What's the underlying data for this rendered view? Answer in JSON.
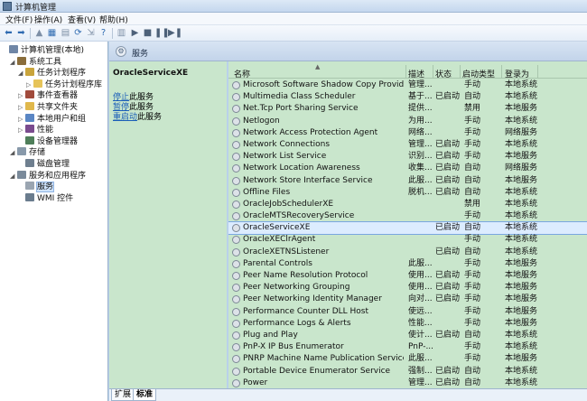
{
  "window": {
    "title": "计算机管理"
  },
  "menu": [
    "文件(F)",
    "操作(A)",
    "查看(V)",
    "帮助(H)"
  ],
  "toolbar": {
    "icons": [
      "back-icon",
      "forward-icon",
      "up-icon",
      "show-hide-tree-icon",
      "properties-icon",
      "refresh-icon",
      "export-icon",
      "help-icon",
      "play-icon",
      "stop-icon",
      "pause-icon",
      "restart-icon"
    ]
  },
  "tree": {
    "items": [
      {
        "label": "计算机管理(本地)",
        "level": 0,
        "twisty": "",
        "icon": "computer-icon",
        "color": "#6f86a6"
      },
      {
        "label": "系统工具",
        "level": 1,
        "twisty": "◢",
        "icon": "tools-icon",
        "color": "#8a6d3b"
      },
      {
        "label": "任务计划程序",
        "level": 2,
        "twisty": "◢",
        "icon": "clock-icon",
        "color": "#c9a43b"
      },
      {
        "label": "任务计划程序库",
        "level": 3,
        "twisty": "▷",
        "icon": "folder-icon",
        "color": "#e6c45a"
      },
      {
        "label": "事件查看器",
        "level": 2,
        "twisty": "▷",
        "icon": "event-viewer-icon",
        "color": "#a14b3c"
      },
      {
        "label": "共享文件夹",
        "level": 2,
        "twisty": "▷",
        "icon": "shared-folder-icon",
        "color": "#e0b84c"
      },
      {
        "label": "本地用户和组",
        "level": 2,
        "twisty": "▷",
        "icon": "users-icon",
        "color": "#5a86c4"
      },
      {
        "label": "性能",
        "level": 2,
        "twisty": "▷",
        "icon": "performance-icon",
        "color": "#7a4b8e"
      },
      {
        "label": "设备管理器",
        "level": 2,
        "twisty": "",
        "icon": "device-manager-icon",
        "color": "#4f7f5a"
      },
      {
        "label": "存储",
        "level": 1,
        "twisty": "◢",
        "icon": "storage-icon",
        "color": "#8899aa"
      },
      {
        "label": "磁盘管理",
        "level": 2,
        "twisty": "",
        "icon": "disk-icon",
        "color": "#6f7f8f"
      },
      {
        "label": "服务和应用程序",
        "level": 1,
        "twisty": "◢",
        "icon": "services-apps-icon",
        "color": "#7a8a9a"
      },
      {
        "label": "服务",
        "level": 2,
        "twisty": "",
        "icon": "services-icon",
        "color": "#9aa5b1",
        "selected": true
      },
      {
        "label": "WMI 控件",
        "level": 2,
        "twisty": "",
        "icon": "wmi-icon",
        "color": "#6a7c8e"
      }
    ]
  },
  "services_header": {
    "title": "服务"
  },
  "detail": {
    "service_name": "OracleServiceXE",
    "links": [
      {
        "link": "停止",
        "suffix": "此服务"
      },
      {
        "link": "暂停",
        "suffix": "此服务"
      },
      {
        "link": "重启动",
        "suffix": "此服务"
      }
    ]
  },
  "columns": {
    "name": "名称",
    "desc": "描述",
    "status": "状态",
    "startup": "启动类型",
    "logon": "登录为"
  },
  "services": [
    {
      "name": "Microsoft Software Shadow Copy Provider",
      "desc": "管理...",
      "status": "",
      "startup": "手动",
      "logon": "本地系统"
    },
    {
      "name": "Multimedia Class Scheduler",
      "desc": "基于...",
      "status": "已启动",
      "startup": "自动",
      "logon": "本地系统"
    },
    {
      "name": "Net.Tcp Port Sharing Service",
      "desc": "提供...",
      "status": "",
      "startup": "禁用",
      "logon": "本地服务"
    },
    {
      "name": "Netlogon",
      "desc": "为用...",
      "status": "",
      "startup": "手动",
      "logon": "本地系统"
    },
    {
      "name": "Network Access Protection Agent",
      "desc": "网络...",
      "status": "",
      "startup": "手动",
      "logon": "网络服务"
    },
    {
      "name": "Network Connections",
      "desc": "管理...",
      "status": "已启动",
      "startup": "手动",
      "logon": "本地系统"
    },
    {
      "name": "Network List Service",
      "desc": "识别...",
      "status": "已启动",
      "startup": "手动",
      "logon": "本地服务"
    },
    {
      "name": "Network Location Awareness",
      "desc": "收集...",
      "status": "已启动",
      "startup": "自动",
      "logon": "网络服务"
    },
    {
      "name": "Network Store Interface Service",
      "desc": "此服...",
      "status": "已启动",
      "startup": "自动",
      "logon": "本地服务"
    },
    {
      "name": "Offline Files",
      "desc": "脱机...",
      "status": "已启动",
      "startup": "自动",
      "logon": "本地系统"
    },
    {
      "name": "OracleJobSchedulerXE",
      "desc": "",
      "status": "",
      "startup": "禁用",
      "logon": "本地系统"
    },
    {
      "name": "OracleMTSRecoveryService",
      "desc": "",
      "status": "",
      "startup": "手动",
      "logon": "本地系统"
    },
    {
      "name": "OracleServiceXE",
      "desc": "",
      "status": "已启动",
      "startup": "自动",
      "logon": "本地系统",
      "selected": true
    },
    {
      "name": "OracleXEClrAgent",
      "desc": "",
      "status": "",
      "startup": "手动",
      "logon": "本地系统"
    },
    {
      "name": "OracleXETNSListener",
      "desc": "",
      "status": "已启动",
      "startup": "自动",
      "logon": "本地系统"
    },
    {
      "name": "Parental Controls",
      "desc": "此服...",
      "status": "",
      "startup": "手动",
      "logon": "本地服务"
    },
    {
      "name": "Peer Name Resolution Protocol",
      "desc": "使用...",
      "status": "已启动",
      "startup": "手动",
      "logon": "本地服务"
    },
    {
      "name": "Peer Networking Grouping",
      "desc": "使用...",
      "status": "已启动",
      "startup": "手动",
      "logon": "本地服务"
    },
    {
      "name": "Peer Networking Identity Manager",
      "desc": "向对...",
      "status": "已启动",
      "startup": "手动",
      "logon": "本地服务"
    },
    {
      "name": "Performance Counter DLL Host",
      "desc": "使远...",
      "status": "",
      "startup": "手动",
      "logon": "本地服务"
    },
    {
      "name": "Performance Logs & Alerts",
      "desc": "性能...",
      "status": "",
      "startup": "手动",
      "logon": "本地服务"
    },
    {
      "name": "Plug and Play",
      "desc": "使计...",
      "status": "已启动",
      "startup": "自动",
      "logon": "本地系统"
    },
    {
      "name": "PnP-X IP Bus Enumerator",
      "desc": "PnP-...",
      "status": "",
      "startup": "手动",
      "logon": "本地系统"
    },
    {
      "name": "PNRP Machine Name Publication Service",
      "desc": "此服...",
      "status": "",
      "startup": "手动",
      "logon": "本地服务"
    },
    {
      "name": "Portable Device Enumerator Service",
      "desc": "强制...",
      "status": "已启动",
      "startup": "自动",
      "logon": "本地系统"
    },
    {
      "name": "Power",
      "desc": "管理...",
      "status": "已启动",
      "startup": "自动",
      "logon": "本地系统"
    }
  ],
  "tabs": [
    "扩展",
    "标准"
  ]
}
